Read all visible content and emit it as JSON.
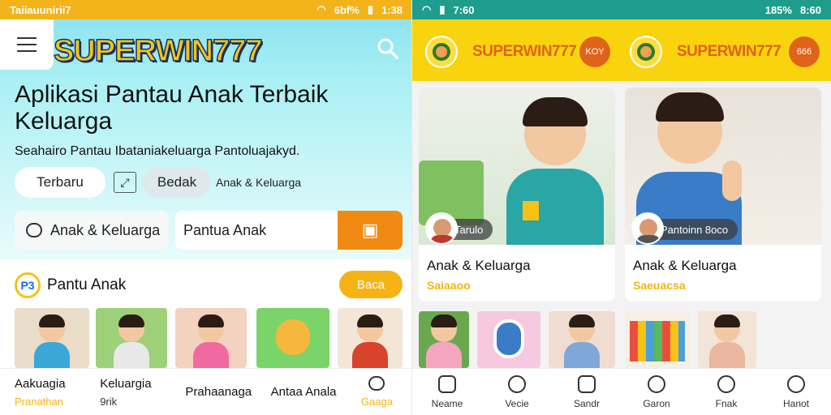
{
  "left": {
    "status": {
      "left": "Taiiauunirii7",
      "right": "6bf%",
      "time": "1:38"
    },
    "brand": "SUPERWIN777",
    "hero_title": "Aplikasi Pantau Anak Terbaik Keluarga",
    "hero_sub": "Seahairo Pantau Ibataniakeluarga Pantoluajakyd.",
    "pills": {
      "terbaru": "Terbaru",
      "bedak": "Bedak",
      "anak": "Anak & Keluarga"
    },
    "search": {
      "left_label": "Anak & Keluarga",
      "placeholder": "Pantua Anak"
    },
    "section": {
      "icon_text": "P3",
      "title": "Pantu Anak",
      "button": "Baca"
    },
    "bottom_nav": [
      {
        "label": "Aakuagia",
        "sub": "Pranathan",
        "accent": true
      },
      {
        "label": "Keluargia",
        "sub": "9rik",
        "accent": false
      },
      {
        "label": "Prahaanaga",
        "sub": "",
        "accent": false
      },
      {
        "label": "Antaa Anala",
        "sub": "",
        "accent": false
      },
      {
        "label": "",
        "sub": "Gaaga",
        "accent": true
      }
    ]
  },
  "right": {
    "status": {
      "left": "",
      "time": "7:60",
      "right": "185%",
      "time2": "8:60"
    },
    "tabs": [
      {
        "brand": "SUPERWIN777",
        "button": "KOY"
      },
      {
        "brand": "SUPERWIN777",
        "button": "666"
      }
    ],
    "cards": [
      {
        "badge": "Tarulo",
        "title": "Anak & Keluarga",
        "sub": "Saiaaoo"
      },
      {
        "badge": "Pantoinn 8oco",
        "title": "Anak & Keluarga",
        "sub": "Saeuacsa"
      }
    ],
    "bottom_nav": [
      "Neame",
      "Vecie",
      "Sandr",
      "Garon",
      "Fnak",
      "Hanot"
    ]
  },
  "colors": {
    "yellow_header": "#f9d40e",
    "orange_accent": "#f08a12",
    "status_left": "#f3b31a",
    "status_right": "#1e9d8c",
    "hero_cyan": "#8fe3ef"
  }
}
